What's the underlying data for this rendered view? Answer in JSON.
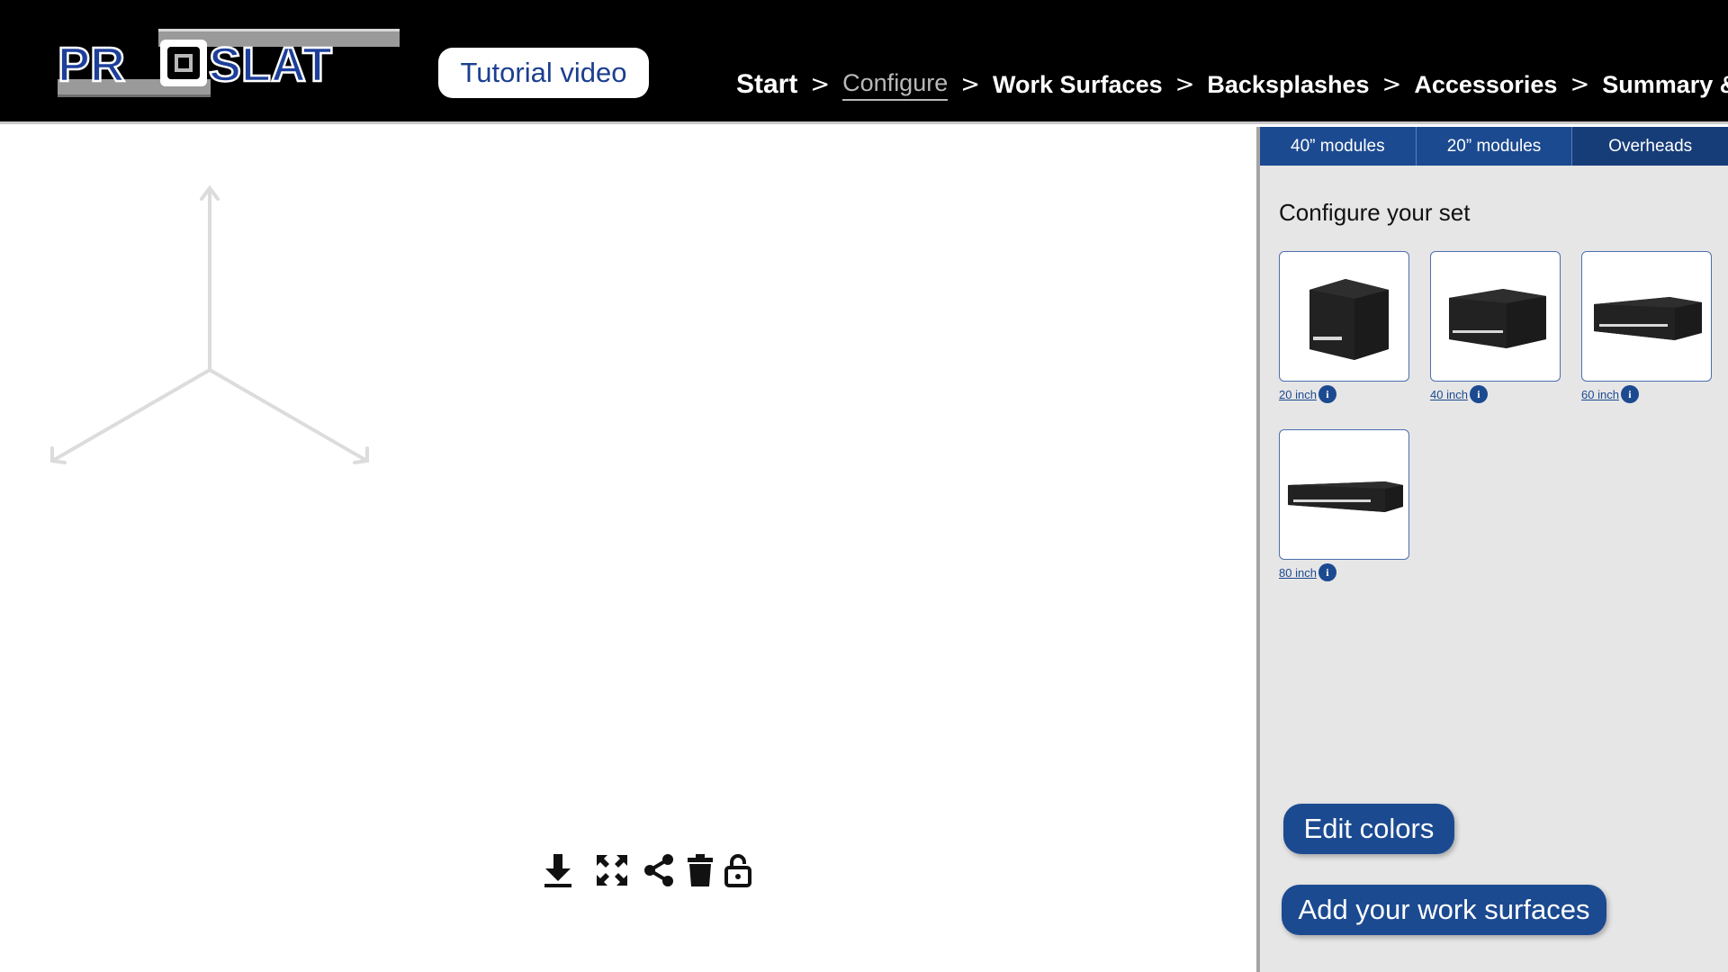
{
  "header": {
    "logo_text": "PROSLAT",
    "tutorial_label": "Tutorial video",
    "breadcrumb": [
      {
        "label": "Start",
        "active": false
      },
      {
        "label": "Configure",
        "active": true
      },
      {
        "label": "Work Surfaces",
        "active": false
      },
      {
        "label": "Backsplashes",
        "active": false
      },
      {
        "label": "Accessories",
        "active": false
      },
      {
        "label": "Summary & quote",
        "active": false
      }
    ],
    "separator": ">"
  },
  "toolbar": {
    "icons": [
      "download-icon",
      "fullscreen-icon",
      "share-icon",
      "delete-icon",
      "lock-icon"
    ]
  },
  "panel": {
    "tabs": [
      "40” modules",
      "20” modules",
      "Overheads"
    ],
    "title": "Configure your set",
    "modules": [
      {
        "label": "20 inch",
        "icon": "info-icon"
      },
      {
        "label": "40 inch",
        "icon": "info-icon"
      },
      {
        "label": "60 inch",
        "icon": "info-icon"
      },
      {
        "label": "80 inch",
        "icon": "info-icon"
      }
    ],
    "edit_colors_label": "Edit colors",
    "add_work_surfaces_label": "Add your work surfaces",
    "info_glyph": "i"
  },
  "colors": {
    "brand_blue": "#1c4a91",
    "header_bg": "#000000",
    "panel_bg": "#e6e6e6"
  }
}
